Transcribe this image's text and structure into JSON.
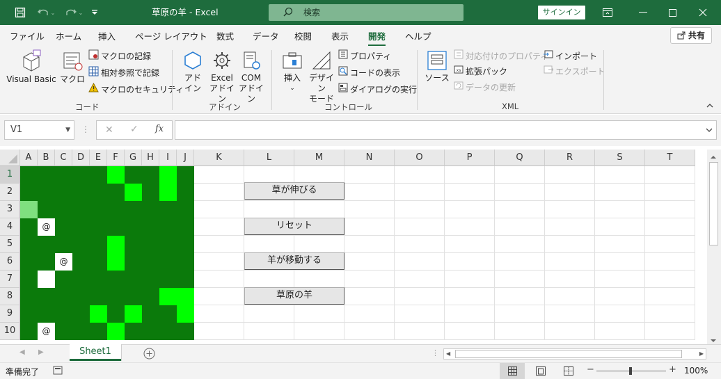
{
  "titlebar": {
    "title": "草原の羊  -  Excel",
    "search_label": "検索",
    "signin_label": "サインイン"
  },
  "ribbon_tabs": [
    "ファイル",
    "ホーム",
    "挿入",
    "ページ レイアウト",
    "数式",
    "データ",
    "校閲",
    "表示",
    "開発",
    "ヘルプ"
  ],
  "active_tab": "開発",
  "share_label": "共有",
  "ribbon": {
    "code": {
      "group_label": "コード",
      "visual_basic": "Visual Basic",
      "macro": "マクロ",
      "record_macro": "マクロの記録",
      "relative_ref": "相対参照で記録",
      "macro_security": "マクロのセキュリティ"
    },
    "addins": {
      "group_label": "アドイン",
      "addin_line1": "アド",
      "addin_line2": "イン",
      "excel_addin_line1": "Excel",
      "excel_addin_line2": "アドイン",
      "com_addin_line1": "COM",
      "com_addin_line2": "アドイン"
    },
    "controls": {
      "group_label": "コントロール",
      "insert": "挿入",
      "design_line1": "デザイン",
      "design_line2": "モード",
      "properties": "プロパティ",
      "view_code": "コードの表示",
      "run_dialog": "ダイアログの実行"
    },
    "xml": {
      "group_label": "XML",
      "source": "ソース",
      "map_properties": "対応付けのプロパティ",
      "expansion_packs": "拡張パック",
      "refresh_data": "データの更新",
      "import": "インポート",
      "export": "エクスポート"
    }
  },
  "formula_bar": {
    "name_box": "V1",
    "formula": ""
  },
  "columns": [
    "A",
    "B",
    "C",
    "D",
    "E",
    "F",
    "G",
    "H",
    "I",
    "J",
    "K",
    "L",
    "M",
    "N",
    "O",
    "P",
    "Q",
    "R",
    "S",
    "T"
  ],
  "rows": [
    "1",
    "2",
    "3",
    "4",
    "5",
    "6",
    "7",
    "8",
    "9",
    "10"
  ],
  "selected_row": "1",
  "colors": {
    "dark_green": "#0b7a0b",
    "bright_green": "#00ff00",
    "light_green": "#7fe07f",
    "white": "#ffffff",
    "title_green": "#1e6c3d"
  },
  "meadow": [
    "DDDDDBDDBD",
    "DDDDDDBDBD",
    "LDDDDDDDDD",
    "DWDDDDDDDD",
    "DDDDDBDDDD",
    "DDWDDBDDDD",
    "DWDDDDDDDD",
    "DDDDDDDDBB",
    "DDDDBDBDDB",
    "DWDDDBDDDD"
  ],
  "sheep": [
    {
      "row": 4,
      "col": 2,
      "symbol": "@"
    },
    {
      "row": 6,
      "col": 3,
      "symbol": "@"
    },
    {
      "row": 10,
      "col": 2,
      "symbol": "@"
    }
  ],
  "macro_buttons": {
    "grow_grass": "草が伸びる",
    "reset": "リセット",
    "move_sheep": "羊が移動する",
    "meadow_sheep": "草原の羊"
  },
  "sheet_tab": "Sheet1",
  "status": {
    "ready": "準備完了",
    "zoom": "100%"
  }
}
